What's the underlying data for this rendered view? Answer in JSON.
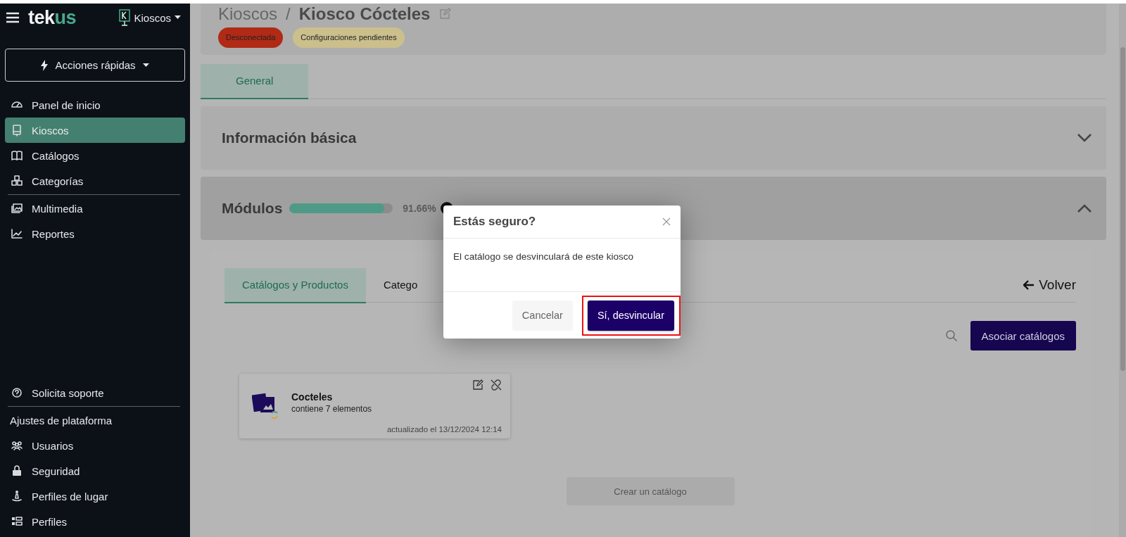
{
  "sidebar": {
    "logo_primary": "tek",
    "logo_accent": "us",
    "module_selector": "Kioscos",
    "quick_actions": "Acciones rápidas",
    "nav_groups": [
      {
        "items": [
          {
            "label": "Panel de inicio",
            "selected": false
          },
          {
            "label": "Kioscos",
            "selected": true
          },
          {
            "label": "Catálogos",
            "selected": false
          },
          {
            "label": "Categorías",
            "selected": false
          }
        ]
      },
      {
        "items": [
          {
            "label": "Multimedia",
            "selected": false
          },
          {
            "label": "Reportes",
            "selected": false
          }
        ]
      }
    ],
    "support": "Solicita soporte",
    "settings_heading": "Ajustes de plataforma",
    "settings_items": [
      {
        "label": "Usuarios"
      },
      {
        "label": "Seguridad"
      },
      {
        "label": "Perfiles de lugar"
      },
      {
        "label": "Perfiles"
      }
    ]
  },
  "header": {
    "breadcrumb_parent": "Kioscos",
    "separator": "/",
    "title": "Kiosco Cócteles",
    "badges": [
      {
        "label": "Desconectada",
        "color": "#b02a15"
      },
      {
        "label": "Configuraciones pendientes",
        "color": "#cbbf8c"
      }
    ]
  },
  "tabs": [
    {
      "label": "General",
      "selected": true
    }
  ],
  "sections": [
    {
      "title": "Información básica",
      "expanded": false
    },
    {
      "title": "Módulos",
      "expanded": true,
      "level": 0.9166,
      "reading": "91.66%"
    }
  ],
  "modules": {
    "tabs": [
      {
        "label": "Catálogos y Productos",
        "selected": true
      },
      {
        "label": "Catego",
        "selected": false
      }
    ],
    "back": "Volver",
    "associate_button": "Asociar catálogos",
    "catalogs": [
      {
        "name": "Cocteles",
        "count": "contiene 7 elementos",
        "updated": "actualizado el 13/12/2024 12:14"
      }
    ],
    "create_button": "Crear un catálogo"
  },
  "dialog": {
    "title": "Estás seguro?",
    "message": "El catálogo se desvinculará de este kiosco",
    "buttons": [
      {
        "label": "Cancelar",
        "kind": "secondary",
        "highlighted": false
      },
      {
        "label": "Sí, desvincular",
        "kind": "primary",
        "highlighted": true
      }
    ]
  }
}
